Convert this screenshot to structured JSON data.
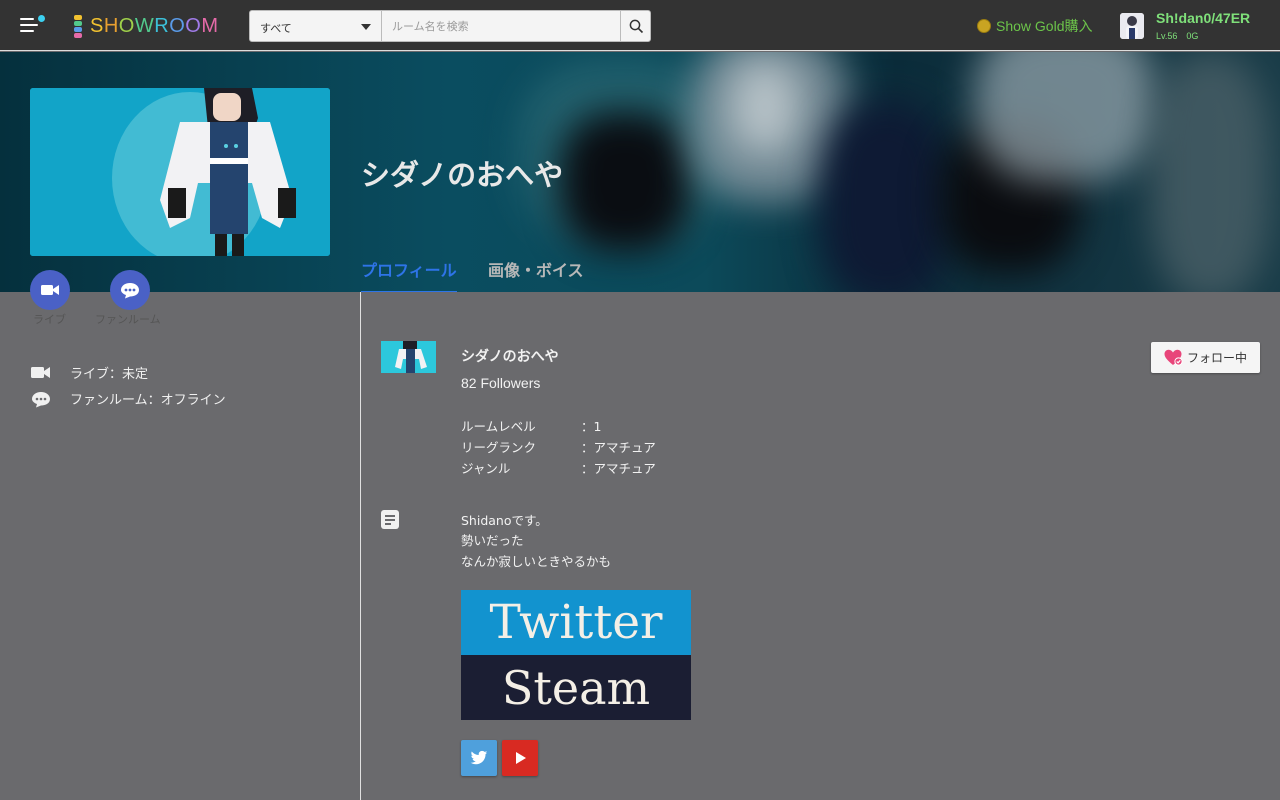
{
  "header": {
    "logo": "SHOWROOM",
    "search_category": "すべて",
    "search_placeholder": "ルーム名を検索",
    "gold_buy": "Show Gold購入",
    "user": {
      "name": "Sh!dan0/47ER",
      "level": "Lv.56",
      "gold": "0G"
    }
  },
  "room": {
    "title": "シダノのおへや",
    "tabs": [
      {
        "label": "プロフィール"
      },
      {
        "label": "画像・ボイス"
      }
    ]
  },
  "actions": {
    "live_label": "ライブ",
    "fanroom_label": "ファンルーム"
  },
  "status": {
    "live": "ライブ：未定",
    "fanroom": "ファンルーム：オフライン"
  },
  "profile": {
    "name": "シダノのおへや",
    "followers": "82 Followers",
    "follow_button": "フォロー中",
    "info": [
      {
        "key": "ルームレベル",
        "value": "：1"
      },
      {
        "key": "リーグランク",
        "value": "：アマチュア"
      },
      {
        "key": "ジャンル",
        "value": "：アマチュア"
      }
    ],
    "description": [
      "Shidanoです。",
      "勢いだった",
      "なんか寂しいときやるかも"
    ],
    "links": {
      "twitter": "Twitter",
      "steam": "Steam"
    }
  },
  "colors": {
    "accent": "#2e74e8",
    "action": "#4a61c6",
    "gold": "#6cc44a",
    "user": "#7fe07a",
    "twitter": "#1293cf",
    "youtube": "#d82a22"
  },
  "icons": [
    "menu-icon",
    "search-icon",
    "coin-icon",
    "camera-icon",
    "chat-icon",
    "heart-icon",
    "document-icon",
    "twitter-icon",
    "youtube-icon"
  ]
}
